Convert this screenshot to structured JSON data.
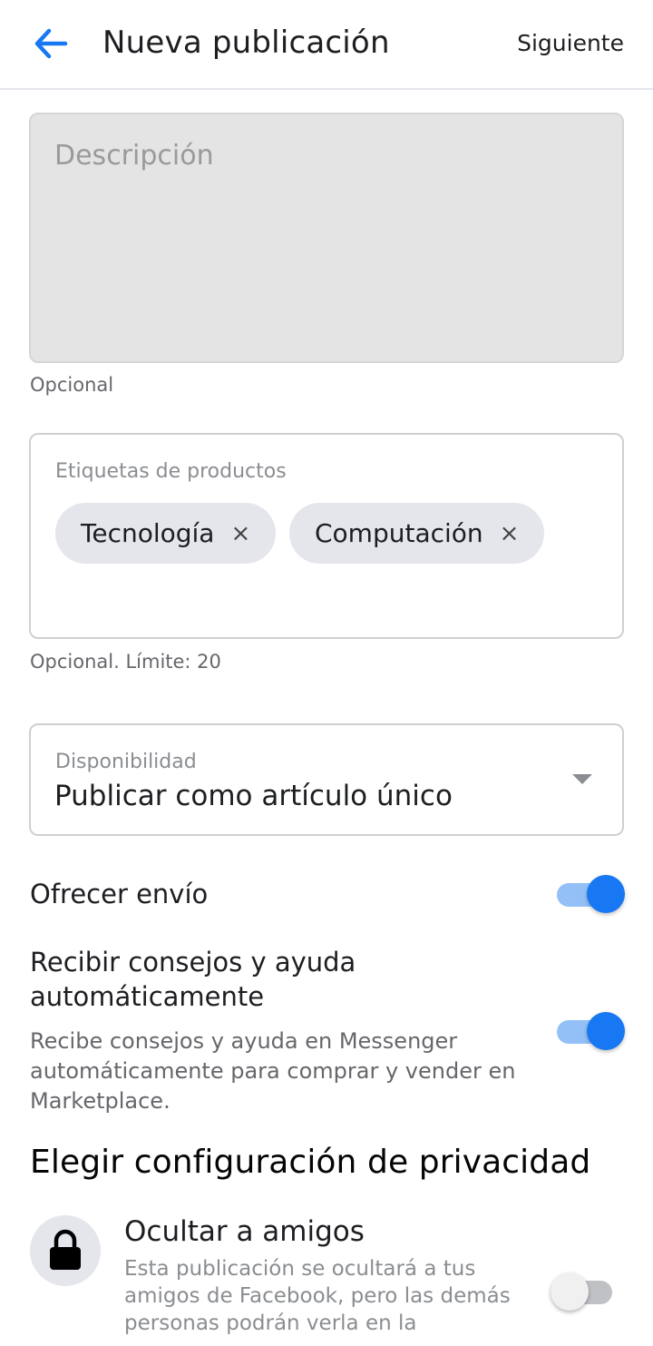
{
  "header": {
    "title": "Nueva publicación",
    "next_label": "Siguiente",
    "back_icon": "arrow-left-icon",
    "accent_color": "#1877f2"
  },
  "description": {
    "placeholder": "Descripción",
    "helper": "Opcional"
  },
  "tags": {
    "label": "Etiquetas de productos",
    "chips": [
      {
        "label": "Tecnología",
        "remove": "×"
      },
      {
        "label": "Computación",
        "remove": "×"
      }
    ],
    "helper": "Opcional. Límite: 20"
  },
  "availability": {
    "label": "Disponibilidad",
    "value": "Publicar como artículo único",
    "icon": "caret-down-icon"
  },
  "shipping": {
    "label": "Ofrecer envío",
    "enabled": true
  },
  "tips": {
    "label": "Recibir consejos y ayuda automáticamente",
    "description": "Recibe consejos y ayuda en Messenger automáticamente para comprar y vender en Marketplace.",
    "enabled": true
  },
  "privacy": {
    "section_title": "Elegir configuración de privacidad",
    "hide_from_friends": {
      "title": "Ocultar a amigos",
      "description": "Esta publicación se ocultará a tus amigos de Facebook, pero las demás personas podrán verla en la",
      "icon": "lock-icon",
      "enabled": false
    }
  }
}
